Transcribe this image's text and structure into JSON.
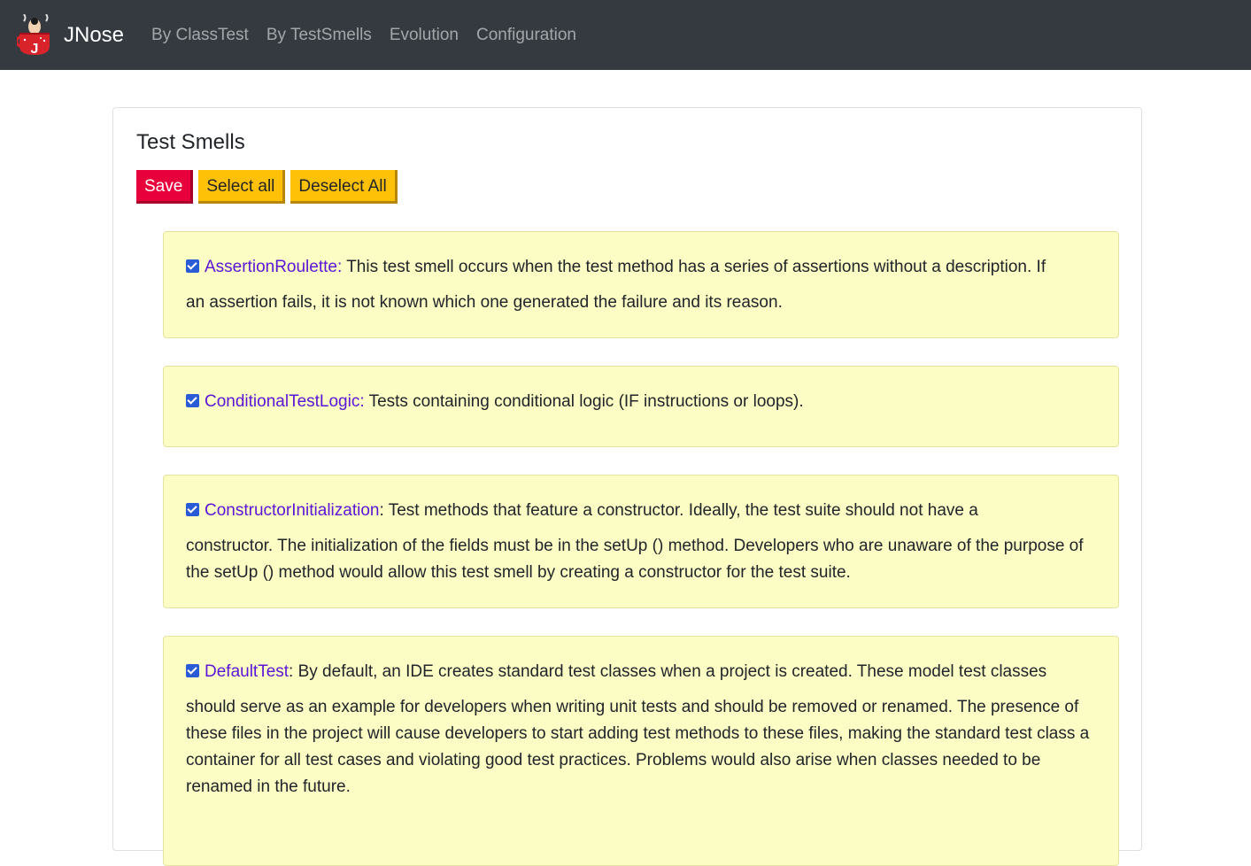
{
  "navbar": {
    "brand": "JNose",
    "links": [
      "By ClassTest",
      "By TestSmells",
      "Evolution",
      "Configuration"
    ]
  },
  "card": {
    "title": "Test Smells",
    "buttons": {
      "save": "Save",
      "select_all": "Select all",
      "deselect_all": "Deselect All"
    }
  },
  "smells": [
    {
      "name": "AssertionRoulette:",
      "checked": true,
      "first_line": "This test smell occurs when the test method has a series of assertions without a description. If",
      "rest": "an assertion fails, it is not known which one generated the failure and its reason."
    },
    {
      "name": "ConditionalTestLogic:",
      "checked": true,
      "first_line": "Tests containing conditional logic (IF instructions or loops).",
      "rest": ""
    },
    {
      "name": "ConstructorInitialization",
      "suffix": ":",
      "checked": true,
      "first_line": "Test methods that feature a constructor. Ideally, the test suite should not have a",
      "rest": "constructor. The initialization of the fields must be in the setUp () method. Developers who are unaware of the purpose of the setUp () method would allow this test smell by creating a constructor for the test suite."
    },
    {
      "name": "DefaultTest",
      "suffix": ":",
      "checked": true,
      "first_line": "By default, an IDE creates standard test classes when a project is created. These model test classes",
      "rest": "should serve as an example for developers when writing unit tests and should be removed or renamed. The presence of these files in the project will cause developers to start adding test methods to these files, making the standard test class a container for all test cases and violating good test practices. Problems would also arise when classes needed to be renamed in the future."
    }
  ],
  "colors": {
    "navbar_bg": "#343a40",
    "save_btn": "#e8003c",
    "yellow_btn": "#ffc107",
    "smell_bg": "#fbfdc4",
    "smell_name": "#5c14d6"
  }
}
